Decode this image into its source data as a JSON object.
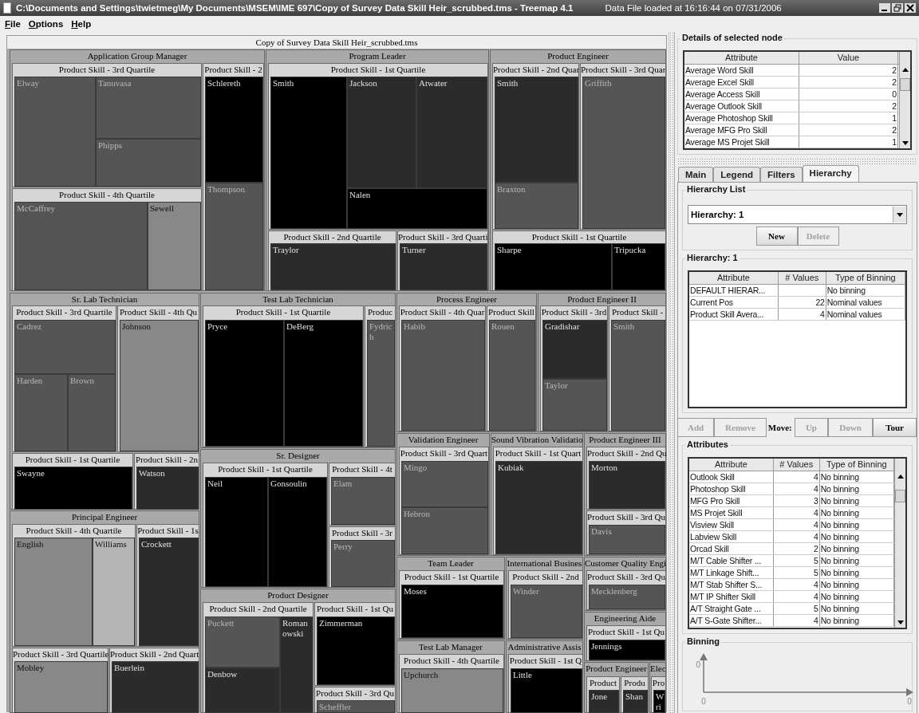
{
  "window": {
    "title": "C:\\Documents and Settings\\twietmeg\\My Documents\\MSEM\\IME 697\\Copy of Survey Data Skill Heir_scrubbed.tms - Treemap 4.1",
    "status": "Data File loaded at 16:16:44 on 07/31/2006"
  },
  "menu": [
    "File",
    "Options",
    "Help"
  ],
  "treemap": {
    "title": "Copy of Survey Data Skill Heir_scrubbed.tms",
    "children": [
      {
        "label": "Application Group Manager",
        "children": [
          {
            "label": "Product Skill - 3rd Quartile",
            "children": [
              {
                "label": "Elway",
                "color": "#555555"
              },
              {
                "label": "Tanuvasa",
                "color": "#555555"
              },
              {
                "label": "Phipps",
                "color": "#555555"
              }
            ]
          },
          {
            "label": "Product Skill - 4th Quartile",
            "children": [
              {
                "label": "McCaffrey",
                "color": "#555555"
              },
              {
                "label": "Sewell",
                "color": "#888888"
              }
            ]
          },
          {
            "label": "Product Skill - 2",
            "children": [
              {
                "label": "Schlereth",
                "color": "#000000"
              },
              {
                "label": "Thompson",
                "color": "#555555"
              }
            ]
          }
        ]
      },
      {
        "label": "Program Leader",
        "children": [
          {
            "label": "Product Skill - 1st Quartile",
            "children": [
              {
                "label": "Smith",
                "color": "#000000"
              },
              {
                "label": "Jackson",
                "color": "#2b2b2b"
              },
              {
                "label": "Atwater",
                "color": "#2b2b2b"
              },
              {
                "label": "Nalen",
                "color": "#000000"
              }
            ]
          },
          {
            "label": "Product Skill - 2nd Quartile",
            "children": [
              {
                "label": "Traylor",
                "color": "#2b2b2b"
              }
            ]
          },
          {
            "label": "Product Skill - 3rd Quarti",
            "children": [
              {
                "label": "Turner",
                "color": "#2b2b2b"
              }
            ]
          }
        ]
      },
      {
        "label": "Product Engineer",
        "children": [
          {
            "label": "Product Skill - 2nd Quar",
            "children": [
              {
                "label": "Smith",
                "color": "#2b2b2b"
              },
              {
                "label": "Braxton",
                "color": "#555555"
              }
            ]
          },
          {
            "label": "Product Skill - 3rd Quar",
            "children": [
              {
                "label": "Griffith",
                "color": "#555555"
              }
            ]
          },
          {
            "label": "Product Skill - 1st Quartile",
            "children": [
              {
                "label": "Sharpe",
                "color": "#000000"
              },
              {
                "label": "Tripucka",
                "color": "#000000"
              }
            ]
          }
        ]
      },
      {
        "label": "Sr. Lab Technician",
        "children": [
          {
            "label": "Product Skill - 3rd Quartile",
            "children": [
              {
                "label": "Cadrez",
                "color": "#555555"
              },
              {
                "label": "Harden",
                "color": "#555555"
              },
              {
                "label": "Brown",
                "color": "#555555"
              }
            ]
          },
          {
            "label": "Product Skill - 4th Qu",
            "children": [
              {
                "label": "Johnson",
                "color": "#888888"
              }
            ]
          },
          {
            "label": "Product Skill - 1st Quartile",
            "children": [
              {
                "label": "Swayne",
                "color": "#000000"
              }
            ]
          },
          {
            "label": "Product Skill - 2n",
            "children": [
              {
                "label": "Watson",
                "color": "#2b2b2b"
              }
            ]
          }
        ]
      },
      {
        "label": "Principal Engineer",
        "children": [
          {
            "label": "Product Skill - 4th Quartile",
            "children": [
              {
                "label": "English",
                "color": "#888888"
              },
              {
                "label": "Williams",
                "color": "#b5b5b5"
              }
            ]
          },
          {
            "label": "Product Skill - 1s",
            "children": [
              {
                "label": "Crockett",
                "color": "#2b2b2b"
              }
            ]
          },
          {
            "label": "Product Skill - 3rd Quartile",
            "children": [
              {
                "label": "Mobley",
                "color": "#888888"
              }
            ]
          },
          {
            "label": "Product Skill - 2nd Quart",
            "children": [
              {
                "label": "Buerlein",
                "color": "#2b2b2b"
              }
            ]
          }
        ]
      },
      {
        "label": "Test Lab Technician",
        "children": [
          {
            "label": "Product Skill - 1st Quartile",
            "children": [
              {
                "label": "Pryce",
                "color": "#000000"
              },
              {
                "label": "DeBerg",
                "color": "#000000"
              }
            ]
          },
          {
            "label": "Produc",
            "children": [
              {
                "label": "Fydrich",
                "color": "#555555"
              }
            ]
          }
        ]
      },
      {
        "label": "Sr. Designer",
        "children": [
          {
            "label": "Product Skill - 1st Quartile",
            "children": [
              {
                "label": "Neil",
                "color": "#000000"
              },
              {
                "label": "Gonsoulin",
                "color": "#000000"
              }
            ]
          },
          {
            "label": "Product Skill - 4t",
            "children": [
              {
                "label": "Elam",
                "color": "#555555"
              }
            ]
          },
          {
            "label": "Product Skill - 3r",
            "children": [
              {
                "label": "Perry",
                "color": "#555555"
              }
            ]
          }
        ]
      },
      {
        "label": "Product Designer",
        "children": [
          {
            "label": "Product Skill - 2nd Quartile",
            "children": [
              {
                "label": "Puckett",
                "color": "#555555"
              },
              {
                "label": "Romanowski",
                "color": "#2b2b2b"
              },
              {
                "label": "Denbow",
                "color": "#2b2b2b"
              }
            ]
          },
          {
            "label": "Product Skill - 1st Qu",
            "children": [
              {
                "label": "Zimmerman",
                "color": "#000000"
              }
            ]
          },
          {
            "label": "Product Skill - 3rd Qu",
            "children": [
              {
                "label": "Scheffler",
                "color": "#555555"
              }
            ]
          }
        ]
      },
      {
        "label": "Process Engineer",
        "children": [
          {
            "label": "Product Skill - 4th Quar",
            "children": [
              {
                "label": "Habib",
                "color": "#555555"
              }
            ]
          },
          {
            "label": "Product Skill",
            "children": [
              {
                "label": "Rouen",
                "color": "#555555"
              }
            ]
          }
        ]
      },
      {
        "label": "Product Engineer II",
        "children": [
          {
            "label": "Product Skill - 3rd",
            "children": [
              {
                "label": "Gradishar",
                "color": "#2b2b2b"
              },
              {
                "label": "Taylor",
                "color": "#555555"
              }
            ]
          },
          {
            "label": "Product Skill -",
            "children": [
              {
                "label": "Smith",
                "color": "#555555"
              }
            ]
          }
        ]
      },
      {
        "label": "Validation Engineer",
        "children": [
          {
            "label": "Product Skill - 3rd Quart",
            "children": [
              {
                "label": "Mingo",
                "color": "#555555"
              },
              {
                "label": "Hebron",
                "color": "#555555"
              }
            ]
          }
        ]
      },
      {
        "label": "Sound Vibration Validatio",
        "children": [
          {
            "label": "Product Skill - 1st Quart",
            "children": [
              {
                "label": "Kubiak",
                "color": "#2b2b2b"
              }
            ]
          }
        ]
      },
      {
        "label": "Product Engineer III",
        "children": [
          {
            "label": "Product Skill - 2nd Qu",
            "children": [
              {
                "label": "Morton",
                "color": "#2b2b2b"
              }
            ]
          },
          {
            "label": "Product Skill - 3rd Qu",
            "children": [
              {
                "label": "Davis",
                "color": "#555555"
              }
            ]
          }
        ]
      },
      {
        "label": "Team Leader",
        "children": [
          {
            "label": "Product Skill - 1st Quartile",
            "children": [
              {
                "label": "Moses",
                "color": "#000000"
              }
            ]
          }
        ]
      },
      {
        "label": "International Busines",
        "children": [
          {
            "label": "Product Skill - 2nd",
            "children": [
              {
                "label": "Winder",
                "color": "#555555"
              }
            ]
          }
        ]
      },
      {
        "label": "Customer Quality Engi",
        "children": [
          {
            "label": "Product Skill - 3rd Qu",
            "children": [
              {
                "label": "Mecklenberg",
                "color": "#555555"
              }
            ]
          }
        ]
      },
      {
        "label": "Test Lab Manager",
        "children": [
          {
            "label": "Product Skill - 4th Quartile",
            "children": [
              {
                "label": "Upchurch",
                "color": "#888888"
              }
            ]
          }
        ]
      },
      {
        "label": "Administrative Assis",
        "children": [
          {
            "label": "Product Skill - 1st Q",
            "children": [
              {
                "label": "Little",
                "color": "#000000"
              }
            ]
          }
        ]
      },
      {
        "label": "Engineering Aide",
        "children": [
          {
            "label": "Product Skill - 1st Qu",
            "children": [
              {
                "label": "Jennings",
                "color": "#000000"
              }
            ]
          }
        ]
      },
      {
        "label": "Product Engineer",
        "children": [
          {
            "label": "Product",
            "children": [
              {
                "label": "Jone",
                "color": "#2b2b2b"
              }
            ]
          },
          {
            "label": "Produ",
            "children": [
              {
                "label": "Shan",
                "color": "#2b2b2b"
              }
            ]
          }
        ]
      },
      {
        "label": "Elec",
        "children": [
          {
            "label": "Pro",
            "children": [
              {
                "label": "Wri",
                "color": "#000000"
              }
            ]
          }
        ]
      }
    ]
  },
  "details": {
    "title": "Details of selected node",
    "columns": [
      "Attribute",
      "Value"
    ],
    "rows": [
      {
        "attribute": "Average Word Skill",
        "value": "2"
      },
      {
        "attribute": "Average Excel Skill",
        "value": "2"
      },
      {
        "attribute": "Average Access Skill",
        "value": "0"
      },
      {
        "attribute": "Average Outlook Skill",
        "value": "2"
      },
      {
        "attribute": "Average Photoshop Skill",
        "value": "1"
      },
      {
        "attribute": "Average MFG Pro Skill",
        "value": "2"
      },
      {
        "attribute": "Average MS Projet Skill",
        "value": "1"
      }
    ]
  },
  "tabs": [
    {
      "label": "Main",
      "selected": false
    },
    {
      "label": "Legend",
      "selected": false
    },
    {
      "label": "Filters",
      "selected": false
    },
    {
      "label": "Hierarchy",
      "selected": true
    }
  ],
  "hierarchy_list": {
    "title": "Hierarchy List",
    "combo": "Hierarchy: 1",
    "buttons": [
      {
        "label": "New",
        "disabled": false
      },
      {
        "label": "Delete",
        "disabled": true
      }
    ]
  },
  "hierarchy": {
    "title": "Hierarchy: 1",
    "columns": [
      "Attribute",
      "# Values",
      "Type of Binning"
    ],
    "rows": [
      {
        "attribute": "DEFAULT HIERAR...",
        "binning": "No binning"
      },
      {
        "attribute": "Current Pos",
        "values": "22",
        "binning": "Nominal values"
      },
      {
        "attribute": "Product Skill Avera...",
        "values": "4",
        "binning": "Nominal values"
      }
    ]
  },
  "actions": [
    {
      "kind": "button",
      "label": "Add",
      "disabled": true
    },
    {
      "kind": "button",
      "label": "Remove",
      "disabled": true
    },
    {
      "kind": "label",
      "label": "Move:"
    },
    {
      "kind": "button",
      "label": "Up",
      "disabled": true
    },
    {
      "kind": "button",
      "label": "Down",
      "disabled": true
    },
    {
      "kind": "button",
      "label": "Tour",
      "disabled": false
    }
  ],
  "attributes": {
    "title": "Attributes",
    "columns": [
      "Attribute",
      "# Values",
      "Type of Binning"
    ],
    "rows": [
      {
        "attribute": "Outlook Skill",
        "values": "4",
        "binning": "No binning"
      },
      {
        "attribute": "Photoshop Skill",
        "values": "4",
        "binning": "No binning"
      },
      {
        "attribute": "MFG Pro Skill",
        "values": "3",
        "binning": "No binning"
      },
      {
        "attribute": "MS Projet Skill",
        "values": "4",
        "binning": "No binning"
      },
      {
        "attribute": "Visview Skill",
        "values": "4",
        "binning": "No binning"
      },
      {
        "attribute": "Labview Skill",
        "values": "4",
        "binning": "No binning"
      },
      {
        "attribute": "Orcad Skill",
        "values": "2",
        "binning": "No binning"
      },
      {
        "attribute": "M/T Cable Shifter ...",
        "values": "5",
        "binning": "No binning"
      },
      {
        "attribute": "M/T Linkage Shift...",
        "values": "5",
        "binning": "No binning"
      },
      {
        "attribute": "M/T Stab Shifter S...",
        "values": "4",
        "binning": "No binning"
      },
      {
        "attribute": "M/T IP Shifter Skill",
        "values": "4",
        "binning": "No binning"
      },
      {
        "attribute": "A/T Straight Gate ...",
        "values": "5",
        "binning": "No binning"
      },
      {
        "attribute": "A/T S-Gate Shifter...",
        "values": "4",
        "binning": "No binning"
      }
    ]
  },
  "binning": {
    "title": "Binning",
    "y_tick": "0",
    "x_start": "0",
    "x_end": "0"
  }
}
